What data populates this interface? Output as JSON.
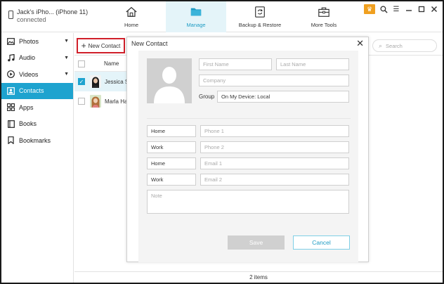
{
  "device": {
    "name": "Jack's iPho... (iPhone 11)",
    "status": "connected"
  },
  "nav": {
    "home": "Home",
    "manage": "Manage",
    "backup": "Backup & Restore",
    "tools": "More Tools"
  },
  "colors": {
    "accent": "#1ea3cf",
    "highlight": "#e4f4f9",
    "badge": "#f0a020",
    "border_red": "#d0202a"
  },
  "sidebar": {
    "items": [
      {
        "label": "Photos",
        "icon": "photo-icon"
      },
      {
        "label": "Audio",
        "icon": "music-icon"
      },
      {
        "label": "Videos",
        "icon": "play-icon"
      },
      {
        "label": "Contacts",
        "icon": "contacts-icon"
      },
      {
        "label": "Apps",
        "icon": "apps-icon"
      },
      {
        "label": "Books",
        "icon": "book-icon"
      },
      {
        "label": "Bookmarks",
        "icon": "bookmark-icon"
      }
    ]
  },
  "toolbar": {
    "new_contact": "New Contact",
    "search_placeholder": "Search"
  },
  "list": {
    "header": "Name",
    "rows": [
      {
        "name": "Jessica S"
      },
      {
        "name": "Marla Ha"
      }
    ]
  },
  "status": {
    "count": "2 items"
  },
  "modal": {
    "title": "New Contact",
    "first_name": "First Name",
    "last_name": "Last Name",
    "company": "Company",
    "group_label": "Group",
    "group_value": "On My Device: Local",
    "phone1_type": "Home",
    "phone1": "Phone 1",
    "phone2_type": "Work",
    "phone2": "Phone 2",
    "email1_type": "Home",
    "email1": "Email 1",
    "email2_type": "Work",
    "email2": "Email 2",
    "note": "Note",
    "save": "Save",
    "cancel": "Cancel"
  }
}
